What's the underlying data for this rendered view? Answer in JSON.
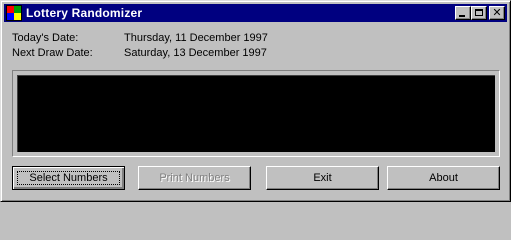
{
  "window": {
    "title": "Lottery Randomizer"
  },
  "info": {
    "todays_date_label": "Today's Date:",
    "todays_date_value": "Thursday, 11 December 1997",
    "next_draw_label": "Next Draw Date:",
    "next_draw_value": "Saturday, 13 December 1997"
  },
  "buttons": {
    "select": "Select Numbers",
    "print": "Print Numbers",
    "exit": "Exit",
    "about": "About"
  },
  "colors": {
    "titlebar": "#000080",
    "face": "#c0c0c0",
    "display": "#000000"
  }
}
